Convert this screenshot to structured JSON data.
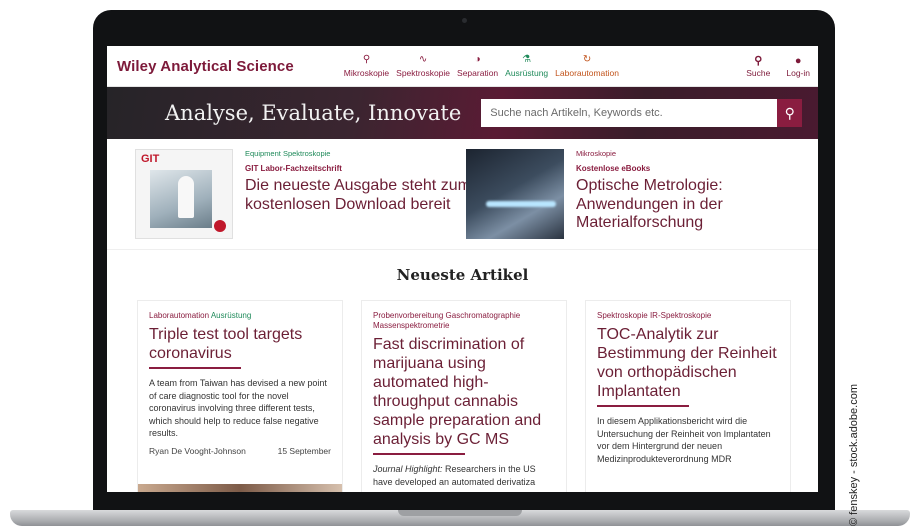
{
  "header": {
    "logo": "Wiley Analytical Science",
    "nav": [
      {
        "label": "Mikroskopie",
        "icon": "microscope-icon",
        "glyph": "⚲"
      },
      {
        "label": "Spektroskopie",
        "icon": "wave-icon",
        "glyph": "∿"
      },
      {
        "label": "Separation",
        "icon": "separation-icon",
        "glyph": "◑"
      },
      {
        "label": "Ausrüstung",
        "icon": "flask-icon",
        "glyph": "⚗"
      },
      {
        "label": "Laborautomation",
        "icon": "refresh-icon",
        "glyph": "↻"
      }
    ],
    "search_label": "Suche",
    "login_label": "Log-in"
  },
  "hero": {
    "tagline": "Analyse, Evaluate, Innovate",
    "search_placeholder": "Suche nach Artikeln, Keywords etc."
  },
  "promos": [
    {
      "category": "Equipment Spektroskopie",
      "kicker": "GIT Labor-Fachzeitschrift",
      "headline": "Die neueste Ausgabe steht zum kostenlosen Download bereit",
      "thumb_text": "GIT"
    },
    {
      "category": "Mikroskopie",
      "kicker": "Kostenlose eBooks",
      "headline": "Optische Metrologie: Anwendungen in der Materialforschung"
    }
  ],
  "latest": {
    "title": "Neueste Artikel",
    "cards": [
      {
        "categories": [
          "Laborautomation",
          "Ausrüstung"
        ],
        "title": "Triple test tool targets coronavirus",
        "body": "A team from Taiwan has devised a new point of care diagnostic tool for the novel coronavirus involving three different tests, which should help to reduce false negative results.",
        "author": "Ryan De Vooght-Johnson",
        "date": "15 September"
      },
      {
        "categories": [
          "Probenvorbereitung",
          "Gaschromatographie",
          "Massenspektrometrie"
        ],
        "title": "Fast discrimination of marijuana using automated high-throughput cannabis sample preparation and analysis by GC MS",
        "body_em": "Journal Highlight:",
        "body": " Researchers in the US have developed an automated derivatiza"
      },
      {
        "categories": [
          "Spektroskopie",
          "IR-Spektroskopie"
        ],
        "title": "TOC-Analytik zur Bestimmung der Reinheit von orthopädischen Implantaten",
        "body": "In diesem Applikationsbericht wird die Untersuchung der Reinheit von Implantaten vor dem Hintergrund der neuen Medizinprodukteverordnung MDR"
      }
    ]
  },
  "credit": "© fenskey - stock.adobe.com",
  "colors": {
    "brand": "#7d1a3a",
    "accent": "#8a1d40",
    "green": "#1f8a5a",
    "orange": "#c2541c"
  }
}
